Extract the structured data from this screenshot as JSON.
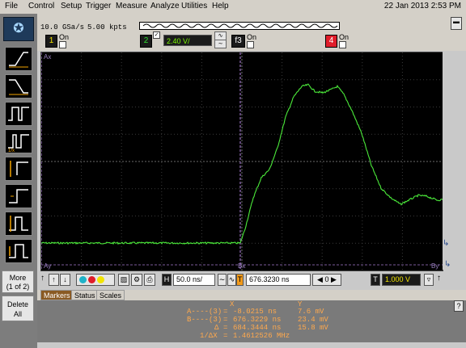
{
  "menu": {
    "items": [
      "File",
      "Control",
      "Setup",
      "Trigger",
      "Measure",
      "Analyze",
      "Utilities",
      "Help"
    ],
    "datetime": "22 Jan 2013  2:53 PM"
  },
  "acquisition": {
    "sample_rate": "10.0 GSa/s",
    "memory_depth": "5.00 kpts"
  },
  "channels": [
    {
      "number": "1",
      "label": "On",
      "color": "#f2e400",
      "enabled": false
    },
    {
      "number": "2",
      "label": "",
      "color": "#2fe02f",
      "enabled": true,
      "scale": "2.40 V/"
    },
    {
      "number": "f3",
      "label": "On",
      "color": "#1a1a1a",
      "enabled": false
    },
    {
      "number": "4",
      "label": "On",
      "color": "#e01d2a",
      "enabled": false
    }
  ],
  "left_panel": {
    "more_label": "More",
    "more_page": "(1 of 2)",
    "delete_line1": "Delete",
    "delete_line2": "All"
  },
  "screen": {
    "marker_ax": "Ax",
    "marker_ay": "Ay",
    "marker_bx": "Bx",
    "marker_by": "By",
    "trace_color": "#4bea3a"
  },
  "controls": {
    "horizontal_label": "H",
    "horizontal_scale": "50.0 ns/",
    "marker_tag": "T",
    "position": "676.3230 ns",
    "channel_value": "0",
    "trigger_label": "T",
    "trigger_level": "1.000 V"
  },
  "tabs": [
    "Markers",
    "Status",
    "Scales"
  ],
  "markers": {
    "col_x": "X",
    "col_y": "Y",
    "a_label": "A----(3)",
    "a_x": "-8.0215 ns",
    "a_y": "7.6 mV",
    "b_label": "B----(3)",
    "b_x": "676.3229 ns",
    "b_y": "23.4 mV",
    "delta_label": "Δ",
    "delta_x": "684.3444 ns",
    "delta_y": "15.8 mV",
    "inv_label": "1/ΔX",
    "inv_x": "1.4612526 MHz"
  }
}
